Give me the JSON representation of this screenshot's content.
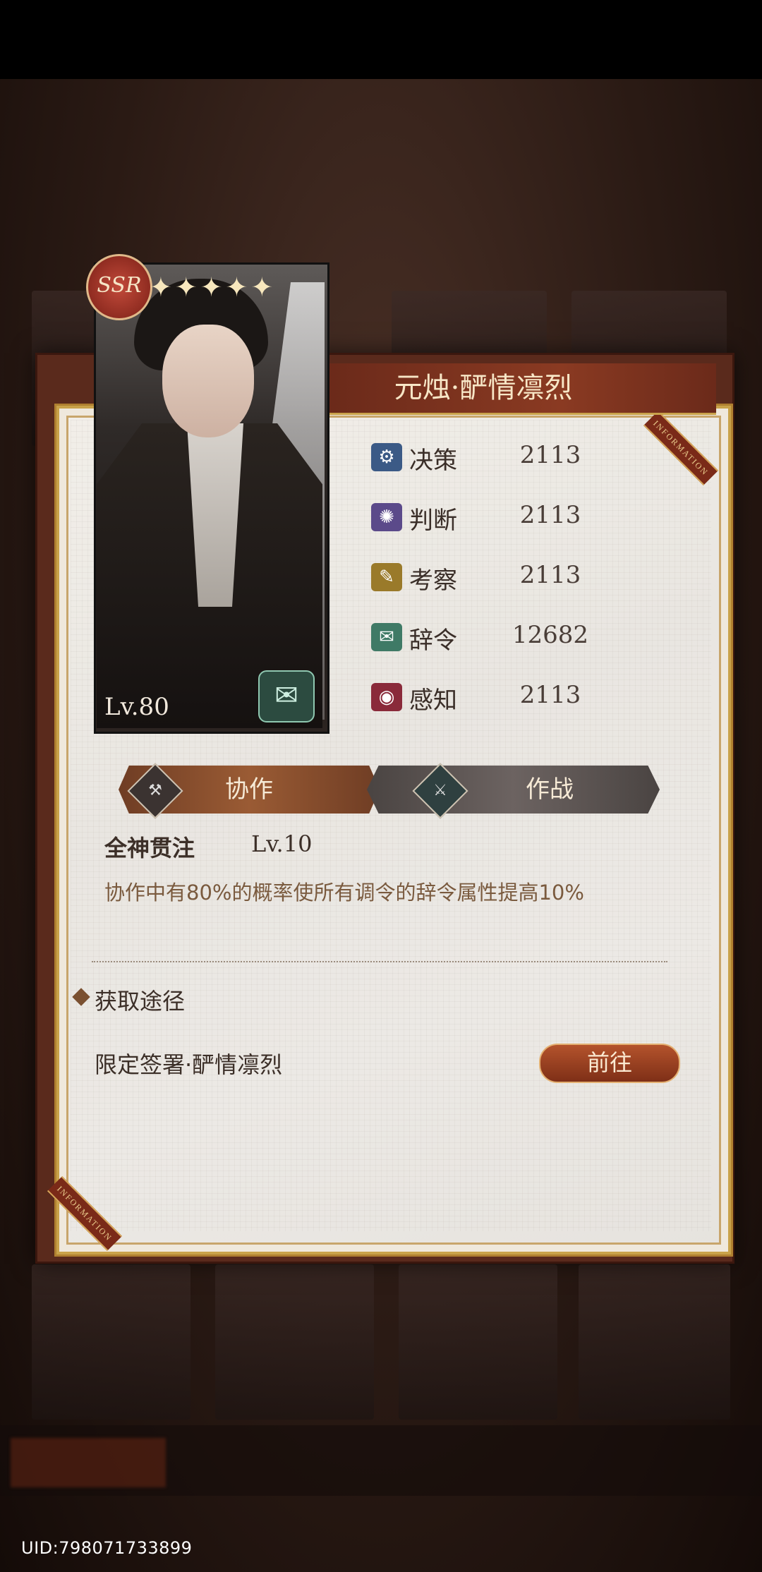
{
  "background": {
    "cards": [
      "",
      "",
      "",
      ""
    ],
    "bottom_tabs": [
      "",
      "",
      "",
      "",
      ""
    ]
  },
  "footer": {
    "uid": "UID:798071733899"
  },
  "card": {
    "rarity": "SSR",
    "stars": "✦✦✦✦✦",
    "level": "Lv.80"
  },
  "panel": {
    "title": "元烛·酽情凛烈",
    "corner_text": "INFORMATION"
  },
  "stats": [
    {
      "icon": "decision-icon",
      "glyph": "⚙",
      "color": "#3b5a86",
      "label": "决策",
      "value": "2113"
    },
    {
      "icon": "judgment-icon",
      "glyph": "✺",
      "color": "#5b4a8a",
      "label": "判断",
      "value": "2113"
    },
    {
      "icon": "investigation-icon",
      "glyph": "✎",
      "color": "#9a7a2a",
      "label": "考察",
      "value": "2113"
    },
    {
      "icon": "rhetoric-icon",
      "glyph": "✉",
      "color": "#3f7a66",
      "label": "辞令",
      "value": "12682"
    },
    {
      "icon": "perception-icon",
      "glyph": "◉",
      "color": "#8a2a3a",
      "label": "感知",
      "value": "2113"
    }
  ],
  "tabs": {
    "coop": "协作",
    "battle": "作战"
  },
  "skill": {
    "name": "全神贯注",
    "level": "Lv.10",
    "description": "协作中有80%的概率使所有调令的辞令属性提高10%"
  },
  "acquisition": {
    "title": "获取途径",
    "source": "限定签署·酽情凛烈",
    "button": "前往"
  }
}
